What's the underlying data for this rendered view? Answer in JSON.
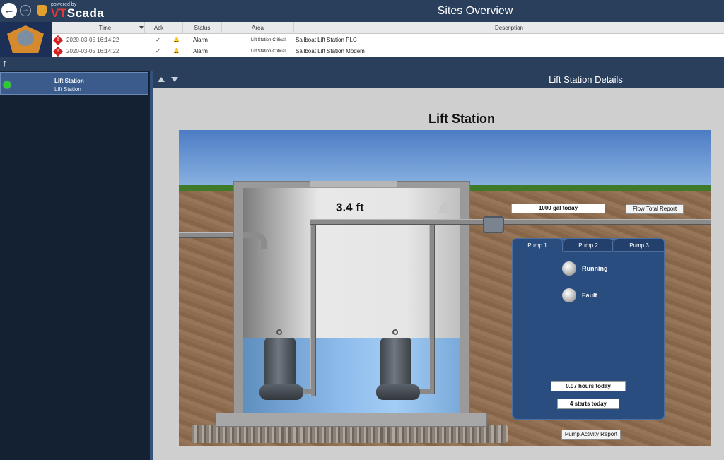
{
  "titlebar": {
    "powered_by": "powered by",
    "brand_prefix": "VT",
    "brand_suffix": "Scada",
    "title": "Sites Overview",
    "back_icon": "arrow-left-icon",
    "forward_icon": "arrow-right-icon"
  },
  "alarm_list": {
    "columns": [
      "Time",
      "Ack",
      "Status",
      "Area",
      "Description"
    ],
    "rows": [
      {
        "marker": "!",
        "time": "2020-03-05  16:14:22",
        "ack": "✔",
        "bell": "🔔",
        "status": "Alarm",
        "area": "Lift Station-Critical",
        "description": "Sailboat Lift Station PLC"
      },
      {
        "marker": "!",
        "time": "2020-03-05  16:14:22",
        "ack": "✔",
        "bell": "🔔",
        "status": "Alarm",
        "area": "Lift Station-Critical",
        "description": "Sailboat Lift Station Modem"
      }
    ]
  },
  "sidebar": {
    "up_arrow": "↑",
    "items": [
      {
        "name": "Lift Station",
        "type": "Lift Station",
        "status_color": "#2ecc2e"
      }
    ]
  },
  "details": {
    "header": "Lift Station Details",
    "station_title": "Lift Station",
    "level": "3.4 ft",
    "flow_today": "1000 gal today",
    "flow_report": "Flow Total Report",
    "pump_tabs": [
      "Pump 1",
      "Pump 2",
      "Pump 3"
    ],
    "active_tab": "Pump 1",
    "indicators": [
      "Running",
      "Fault"
    ],
    "hours_today": "0.07 hours today",
    "starts_today": "4 starts today",
    "activity_report": "Pump Activity Report"
  },
  "colors": {
    "titlebar": "#2a3f5c",
    "panel": "#2a4d7f",
    "alarm_red": "#d32020",
    "status_green": "#2ecc2e"
  }
}
